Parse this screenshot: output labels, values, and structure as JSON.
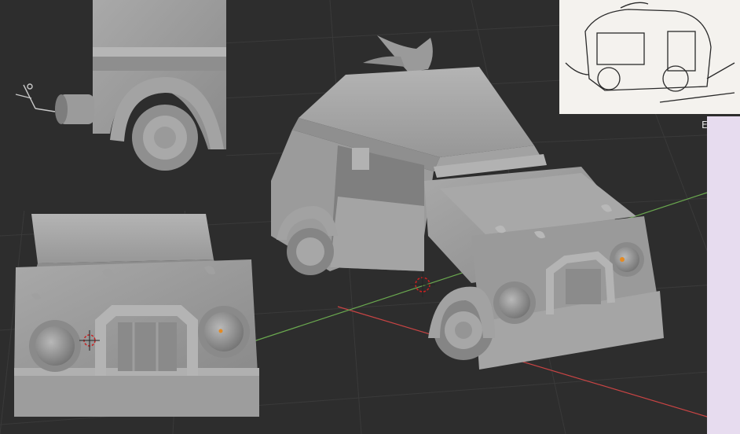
{
  "viewport": {
    "background": "#2d2d2d",
    "grid_color": "#3a3a3a",
    "axis_x_color": "#c84444",
    "axis_y_color": "#6aa84f",
    "model_color": "#9c9c9c"
  },
  "panels": {
    "side_panel_color": "#e7dcef",
    "reference_sketch_bg": "#f4f2ee"
  },
  "corner_letter": "E",
  "icons": {
    "cursor": "3d-cursor-icon",
    "light": "light-origin-icon"
  }
}
